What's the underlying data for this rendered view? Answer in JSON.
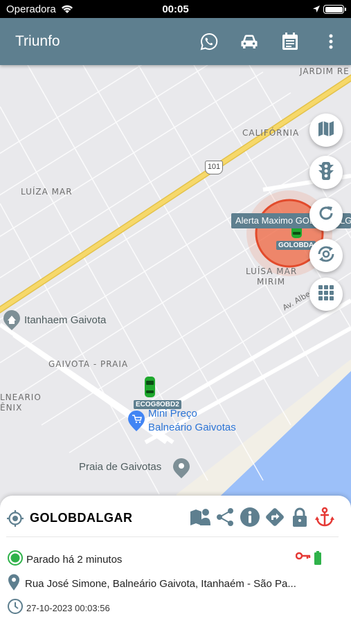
{
  "status_bar": {
    "carrier": "Operadora",
    "time": "00:05"
  },
  "app_bar": {
    "title": "Triunfo",
    "actions": [
      "whatsapp-icon",
      "car-icon",
      "calendar-icon",
      "more-vert-icon"
    ]
  },
  "map": {
    "neighborhoods": {
      "jardim_re": "JARDIM RE",
      "california": "CALIFÓRNIA",
      "luiza_mar": "LUÍZA MAR",
      "luiza_mar_mirim_1": "LUÍSA MAR",
      "luiza_mar_mirim_2": "MIRIM",
      "gaivota_praia": "GAIVOTA - PRAIA",
      "balneario_1": "LNEARIO",
      "balneario_2": "ÊNIX"
    },
    "road_number": "101",
    "street_name": "Av. Albert",
    "pois": {
      "itanhaem_gaivota": "Itanhaem Gaivota",
      "mini_preco_1": "Mini Preço",
      "mini_preco_2": "Balneário Gaivotas",
      "praia_gaivotas": "Praia de Gaivotas"
    },
    "alert_tooltip": "Alerta Maximo GOLOBDALGAR",
    "vehicles": [
      {
        "tag": "GOLOBDA"
      },
      {
        "tag": "ECOG8OBD2"
      }
    ],
    "controls": [
      "map-layers-icon",
      "traffic-light-icon",
      "refresh-icon",
      "auto-refresh-icon",
      "grid-icon"
    ]
  },
  "panel": {
    "vehicle_name": "GOLOBDALGAR",
    "status": "Parado há 2 minutos",
    "address": "Rua José Simone, Balneário Gaivota, Itanhaém - São Pa...",
    "timestamp": "27-10-2023 00:03:56",
    "colors": {
      "stopped": "#2fb24a",
      "ignition_key": "#e53935",
      "battery": "#2fb24a",
      "anchor": "#e53935",
      "icon": "#5e7f8f"
    }
  }
}
